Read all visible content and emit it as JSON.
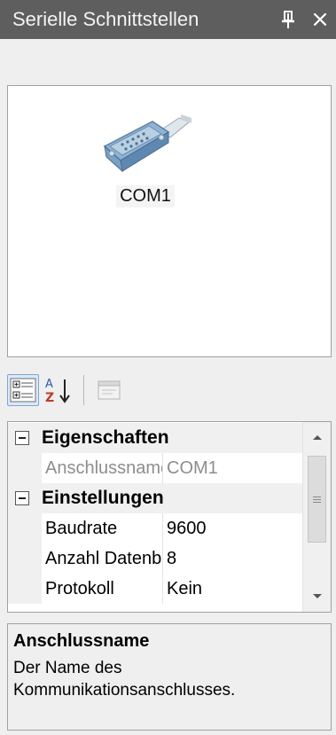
{
  "window": {
    "title": "Serielle Schnittstellen",
    "pin_icon": "pin-icon",
    "close_glyph": "×"
  },
  "devices": [
    {
      "label": "COM1",
      "icon": "serial-connector-icon"
    }
  ],
  "toolbar": {
    "categorized_icon": "categorized-view-icon",
    "alphabetical_icon": "sort-alphabetical-icon",
    "property_pages_icon": "property-pages-icon"
  },
  "properties": {
    "category1": "Eigenschaften",
    "category2": "Einstellungen",
    "rows": [
      {
        "name": "Anschlussname",
        "value": "COM1"
      },
      {
        "name": "Baudrate",
        "value": "9600"
      },
      {
        "name": "Anzahl Datenbits",
        "value": "8"
      },
      {
        "name": "Protokoll",
        "value": "Kein"
      }
    ]
  },
  "description": {
    "title": "Anschlussname",
    "text": "Der Name des Kommunikationsanschlusses."
  },
  "colors": {
    "titlebar": "#5e5e5e",
    "panel_bg": "#efefef",
    "grid_bg": "#ffffff",
    "selected_border": "#7aa7d6"
  }
}
